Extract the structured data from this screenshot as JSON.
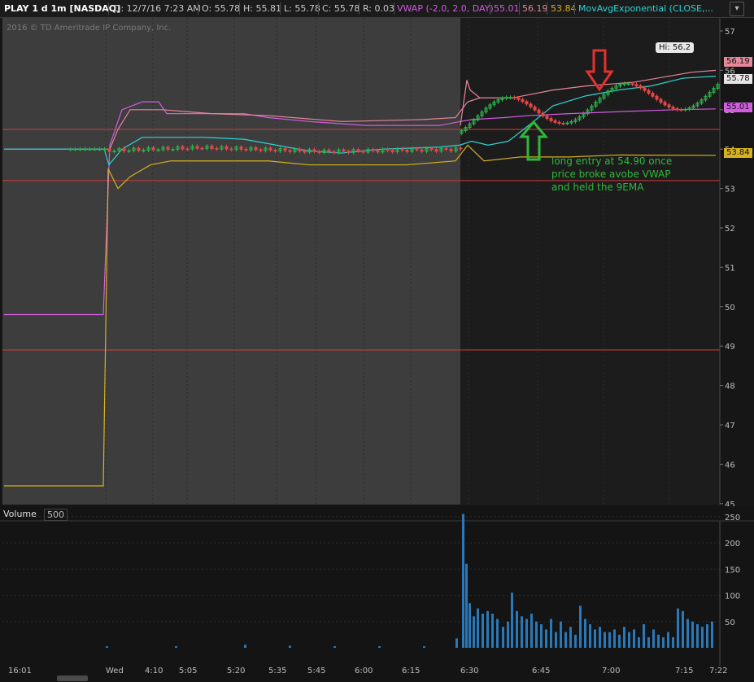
{
  "header": {
    "symbol": "PLAY 1 d 1m [NASDAQ]",
    "date": "D: 12/7/16 7:23 AM",
    "open": "O: 55.78",
    "high": "H: 55.81",
    "low": "L: 55.78",
    "close": "C: 55.78",
    "range": "R: 0.03",
    "vwap_study": "VWAP (-2.0, 2.0, DAY)",
    "vwap_value": "55.01",
    "upper_band": "56.19",
    "lower_band": "53.84",
    "ema_study": "MovAvgExponential (CLOSE,...",
    "menu_icon": "chevron-menu-icon"
  },
  "copyright": "2016 © TD Ameritrade IP Company, Inc.",
  "price_axis": [
    "57",
    "56",
    "55",
    "54",
    "53",
    "52",
    "51",
    "50",
    "49",
    "48",
    "47",
    "46",
    "45"
  ],
  "price_tags": {
    "upper": "56.19",
    "last": "55.78",
    "vwap": "55.01",
    "lower": "53.84"
  },
  "hi_bubble": "Hi: 56.2",
  "annotation": {
    "line1": "long entry at 54.90 once",
    "line2": "price broke avobe VWAP",
    "line3": "and held the 9EMA"
  },
  "volume": {
    "label": "Volume",
    "scale": "500",
    "axis": [
      "250",
      "200",
      "150",
      "100",
      "50"
    ]
  },
  "time_axis": [
    "16:01",
    "Wed",
    "4:10",
    "5:05",
    "5:20",
    "5:35",
    "5:45",
    "6:00",
    "6:15",
    "6:30",
    "6:45",
    "7:00",
    "7:15",
    "7:22"
  ],
  "colors": {
    "vwap": "#d35ce0",
    "upper_band": "#e6879a",
    "lower_band": "#d6b21e",
    "ema": "#2fd3d3",
    "horizontal_level": "#d23a3a",
    "up_candle": "#2bb34a",
    "down_candle": "#e04848",
    "volume_bar": "#2a78b8",
    "annotation": "#2fb93a",
    "premarket_shade": "#3d3d3d"
  }
}
